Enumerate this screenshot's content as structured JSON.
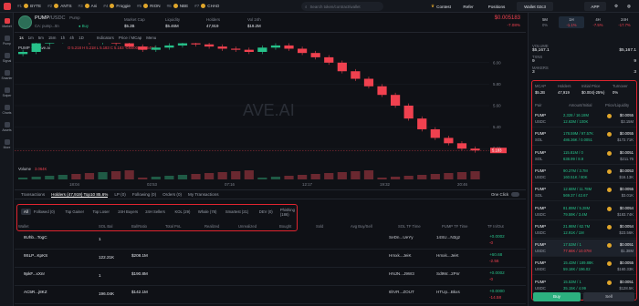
{
  "topbar": {
    "tickers": [
      {
        "rank": "#1",
        "name": "BYTE"
      },
      {
        "rank": "#2",
        "name": "ANTS"
      },
      {
        "rank": "#3",
        "name": "Ani"
      },
      {
        "rank": "#4",
        "name": "Froggie"
      },
      {
        "rank": "#5",
        "name": "RION"
      },
      {
        "rank": "#6",
        "name": "NBE"
      },
      {
        "rank": "#7",
        "name": "CHAD"
      }
    ],
    "search_placeholder": "Search token/contract/wallet",
    "contest_label": "Contest",
    "refer_label": "Refer",
    "positions_label": "Positions",
    "wallet_label": "Wallet 02c3",
    "app_label": "APP"
  },
  "sidebar": {
    "items": [
      {
        "label": "Market"
      },
      {
        "label": "Pump"
      },
      {
        "label": "Signal"
      },
      {
        "label": "Smarter"
      },
      {
        "label": "Sniper"
      },
      {
        "label": "Charts"
      },
      {
        "label": "Assets"
      },
      {
        "label": "More"
      }
    ]
  },
  "token": {
    "symbol": "PUMP",
    "quote": "/USDC",
    "platform": "Pump",
    "ca_label": "CA: pump...ttn",
    "price": "$0.005183",
    "change": "-7.08%",
    "stats": [
      {
        "label": "Market Cap",
        "value": "$5.2B"
      },
      {
        "label": "Liquidity",
        "value": "$5.46M"
      },
      {
        "label": "Holders",
        "value": "47,919"
      },
      {
        "label": "Vol 24h",
        "value": "$19.2M"
      }
    ]
  },
  "charttools": {
    "intervals": [
      "1s",
      "1m",
      "5m",
      "15m",
      "1h",
      "4h",
      "1D"
    ],
    "indicators_label": "Indicators",
    "price_mcap_label": "Price / MCap",
    "menu_label": "Menu",
    "legend": "PUMP · 1 · Ave.ai",
    "ohlc": "O 5.218  H 5.218  L 5.183  C 5.183  -0.00003 (-0.54%)"
  },
  "chart_data": {
    "type": "candlestick",
    "watermark": "AVE.AI",
    "y_ticks": [
      "6.00",
      "5.80",
      "5.60",
      "5.40",
      "5.20"
    ],
    "last_price_label": "5.183",
    "volume_label": "Volume",
    "volume_value": "3.064K",
    "x_ticks": [
      "18:04",
      "02:53",
      "07:16",
      "12:17",
      "19:32",
      "20:46"
    ],
    "close_values": [
      6.1,
      6.18,
      6.2,
      6.22,
      6.21,
      6.19,
      6.2,
      6.18,
      6.15,
      6.12,
      6.14,
      6.16,
      6.18,
      6.17,
      6.15,
      6.13,
      6.12,
      6.1,
      6.14,
      6.16,
      6.13,
      6.09,
      6.05,
      6.0,
      5.92,
      5.85,
      5.78,
      5.7,
      5.6,
      5.48,
      5.38,
      5.3,
      5.25,
      5.2,
      5.183
    ]
  },
  "tabs": {
    "items": [
      "Transactions",
      "Holders (47,919) Top10 85.6%",
      "LP (0)",
      "Following (0)",
      "Orders (0)",
      "My Transactions"
    ],
    "one_click": "One Click"
  },
  "filters": {
    "chips": [
      "All",
      "Followed (0)",
      "Top Gainer",
      "Top Loser",
      "24H Buyers",
      "24H Sellers",
      "KOL (29)",
      "Whale (78)",
      "Smartest (21)",
      "DEV (0)",
      "Phishing (186)"
    ]
  },
  "table": {
    "headers": [
      "Wallet",
      "SOL Bal",
      "Bal/Ratio",
      "Total PnL",
      "Realized",
      "Unrealized",
      "Bought",
      "Sold",
      "Avg Buy/Sell",
      "SOL TF Time",
      "PUMP TF Time",
      "TF In/Out"
    ],
    "rows": [
      {
        "wallet": "8Uhb...TogC",
        "sol_bal": "1",
        "bal_ratio": "",
        "total_pnl": "",
        "bought": "",
        "sold": "",
        "sol_tf": "SeDn...UeYy",
        "pump_tf": "14SU...N3gz",
        "tf": "+0.0002",
        "tf2": "-0"
      },
      {
        "wallet": "9SLP...KpKS",
        "sol_bal": "122.21K",
        "bal_ratio": "$208.1M",
        "total_pnl": "",
        "bought": "",
        "sold": "",
        "sol_tf": "Hmxk...JeiK",
        "pump_tf": "Hmxk...JeiK",
        "tf": "+60.68",
        "tf2": "-2.56"
      },
      {
        "wallet": "9pkF...xXnr",
        "sol_bal": "1",
        "bal_ratio": "$190.8M",
        "total_pnl": "",
        "bought": "",
        "sold": "",
        "sol_tf": "HNJN...J9W3",
        "pump_tf": "Sd9W...2Pnr",
        "tf": "+0.0002",
        "tf2": "-0"
      },
      {
        "wallet": "AC5R...j8KZ",
        "sol_bal": "196.04K",
        "bal_ratio": "$142.1M",
        "total_pnl": "",
        "bought": "",
        "sold": "",
        "sol_tf": "6hVR...ZOUT",
        "pump_tf": "HTUp...Bkxs",
        "tf": "+0.0000",
        "tf2": "-14.58"
      }
    ]
  },
  "rightpanel": {
    "times": [
      {
        "label": "5M",
        "pct": "0%"
      },
      {
        "label": "1H",
        "pct": "-1.1%"
      },
      {
        "label": "4H",
        "pct": "-7.5%"
      },
      {
        "label": "24H",
        "pct": "-17.7%"
      }
    ],
    "stats": [
      {
        "label": "VOLUME",
        "value": "$5,167.1",
        "value2": "$5,167.1"
      },
      {
        "label": "TXNS",
        "value": "9",
        "value2": "9"
      },
      {
        "label": "MAKERS",
        "value": "3",
        "value2": "3"
      }
    ],
    "mcap": [
      {
        "label": "MCAP",
        "value": "$5.2B"
      },
      {
        "label": "Holders",
        "value": "47,919"
      },
      {
        "label": "Initial Price",
        "value": "$0.004(-25%)"
      },
      {
        "label": "Turnover",
        "value": "0%"
      }
    ],
    "tx_headers": [
      "Pair",
      "Amount/Initial",
      "Price/Liquidity"
    ],
    "txs": [
      {
        "pair": "PUMP",
        "quote": "USDC",
        "amount": "2,328 / 16.18M",
        "amount2": "12.63M / 100K",
        "price": "$0.0055",
        "liq": "$3.15M"
      },
      {
        "pair": "PUMP",
        "quote": "SOL",
        "amount": "178.59M / 97.57K",
        "amount2": "486.36K / 0.0051",
        "price": "$0.0055",
        "liq": "$172.71K"
      },
      {
        "pair": "PUMP",
        "quote": "SOL",
        "amount": "115.81M / 0",
        "amount2": "638.99 / 8.9",
        "price": "$0.0051",
        "liq": "$211.76"
      },
      {
        "pair": "PUMP",
        "quote": "USDC",
        "amount": "90.27M / 3.7M",
        "amount2": "160.51K / 80K",
        "price": "$0.0053",
        "liq": "$16.13K"
      },
      {
        "pair": "PUMP",
        "quote": "SOL",
        "amount": "12.68M / 11.78M",
        "amount2": "569.37 / 42.67",
        "price": "$0.0055",
        "liq": "$3.01K"
      },
      {
        "pair": "PUMP",
        "quote": "USDC",
        "amount": "81.89M / 5.28M",
        "amount2": "79.59K / 3.4M",
        "price": "$0.0054",
        "liq": "$183.74K"
      },
      {
        "pair": "PUMP",
        "quote": "USDC",
        "amount": "21.98M / 62.7M",
        "amount2": "12.91K / 1M",
        "price": "$0.0054",
        "liq": "$23.56K"
      },
      {
        "pair": "PUMP",
        "quote": "USDC",
        "amount": "17.53M / 1",
        "amount2": "77.66K / 10.07M",
        "price": "$0.0051",
        "liq": "$1.38M"
      },
      {
        "pair": "PUMP",
        "quote": "USDC",
        "amount": "15.43M / 189.88K",
        "amount2": "59.18K / 196.02",
        "price": "$0.0055",
        "liq": "$160.33K"
      },
      {
        "pair": "PUMP",
        "quote": "USDC",
        "amount": "15.53M / 1",
        "amount2": "35.15K / 4.99",
        "price": "$0.0051",
        "liq": "$128.5K"
      }
    ],
    "buy_label": "Buy",
    "sell_label": "Sell",
    "order_tabs": [
      "Market",
      "Limit"
    ],
    "presets": [
      "S1",
      "S2",
      "S3"
    ]
  }
}
